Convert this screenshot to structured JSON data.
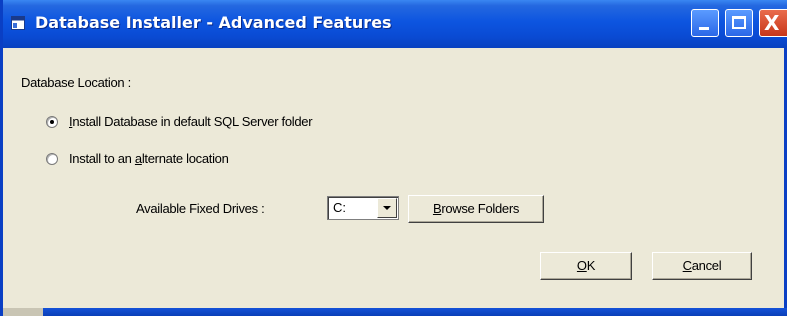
{
  "window": {
    "title": "Database Installer - Advanced Features"
  },
  "titlebar_buttons": {
    "minimize_icon": "minimize-icon",
    "maximize_icon": "maximize-icon",
    "close_icon": "close-icon",
    "close_glyph": "X"
  },
  "section": {
    "location_label": "Database Location :"
  },
  "options": {
    "default_pre": "",
    "default_mnemonic": "I",
    "default_post": "nstall Database in default SQL Server folder",
    "default_selected": true,
    "alternate_pre": "Install to an ",
    "alternate_mnemonic": "a",
    "alternate_post": "lternate location",
    "alternate_selected": false
  },
  "drives": {
    "label": "Available Fixed Drives :",
    "selected_value": "C:",
    "browse_mnemonic": "B",
    "browse_rest": "rowse Folders"
  },
  "buttons": {
    "ok_mnemonic": "O",
    "ok_rest": "K",
    "cancel_mnemonic": "C",
    "cancel_rest": "ancel"
  },
  "colors": {
    "titlebar": "#0a4bd4",
    "dialog_face": "#ece9d8",
    "close_button": "#c8371a"
  }
}
